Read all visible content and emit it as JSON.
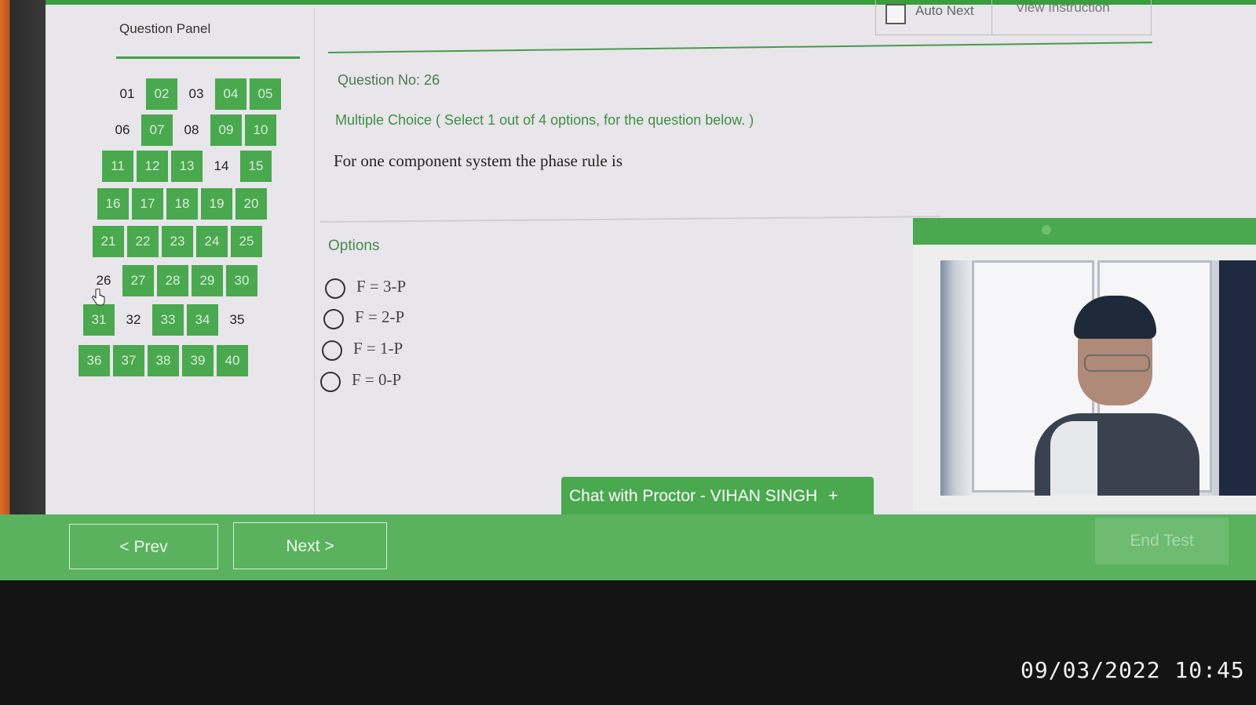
{
  "panel": {
    "title": "Question Panel",
    "questions": [
      {
        "n": "01",
        "state": "unanswered"
      },
      {
        "n": "02",
        "state": "answered"
      },
      {
        "n": "03",
        "state": "unanswered"
      },
      {
        "n": "04",
        "state": "answered"
      },
      {
        "n": "05",
        "state": "answered"
      },
      {
        "n": "06",
        "state": "unanswered"
      },
      {
        "n": "07",
        "state": "answered"
      },
      {
        "n": "08",
        "state": "unanswered"
      },
      {
        "n": "09",
        "state": "answered"
      },
      {
        "n": "10",
        "state": "answered"
      },
      {
        "n": "11",
        "state": "answered"
      },
      {
        "n": "12",
        "state": "answered"
      },
      {
        "n": "13",
        "state": "answered"
      },
      {
        "n": "14",
        "state": "unanswered"
      },
      {
        "n": "15",
        "state": "answered"
      },
      {
        "n": "16",
        "state": "answered"
      },
      {
        "n": "17",
        "state": "answered"
      },
      {
        "n": "18",
        "state": "answered"
      },
      {
        "n": "19",
        "state": "answered"
      },
      {
        "n": "20",
        "state": "answered"
      },
      {
        "n": "21",
        "state": "answered"
      },
      {
        "n": "22",
        "state": "answered"
      },
      {
        "n": "23",
        "state": "answered"
      },
      {
        "n": "24",
        "state": "answered"
      },
      {
        "n": "25",
        "state": "answered"
      },
      {
        "n": "26",
        "state": "current"
      },
      {
        "n": "27",
        "state": "answered"
      },
      {
        "n": "28",
        "state": "answered"
      },
      {
        "n": "29",
        "state": "answered"
      },
      {
        "n": "30",
        "state": "answered"
      },
      {
        "n": "31",
        "state": "answered"
      },
      {
        "n": "32",
        "state": "unanswered"
      },
      {
        "n": "33",
        "state": "answered"
      },
      {
        "n": "34",
        "state": "answered"
      },
      {
        "n": "35",
        "state": "unanswered"
      },
      {
        "n": "36",
        "state": "answered"
      },
      {
        "n": "37",
        "state": "answered"
      },
      {
        "n": "38",
        "state": "answered"
      },
      {
        "n": "39",
        "state": "answered"
      },
      {
        "n": "40",
        "state": "answered"
      }
    ]
  },
  "header": {
    "auto_next_label": "Auto Next",
    "view_instruction_label": "View Instruction"
  },
  "question": {
    "number_label": "Question No: 26",
    "type_label": "Multiple Choice ( Select 1 out of 4 options, for the question below. )",
    "text": "For one component system the phase rule is",
    "options_title": "Options",
    "options": [
      "F = 3-P",
      "F = 2-P",
      "F = 1-P",
      "F = 0-P"
    ]
  },
  "chat": {
    "label": "Chat with Proctor - VIHAN SINGH",
    "plus": "+"
  },
  "footer": {
    "prev_label": "< Prev",
    "next_label": "Next >",
    "end_label": "End Test"
  },
  "timestamp": "09/03/2022 10:45",
  "colors": {
    "accent": "#4aa84f",
    "footer": "#5ab25f",
    "answered_text": "#d7f0d8"
  }
}
